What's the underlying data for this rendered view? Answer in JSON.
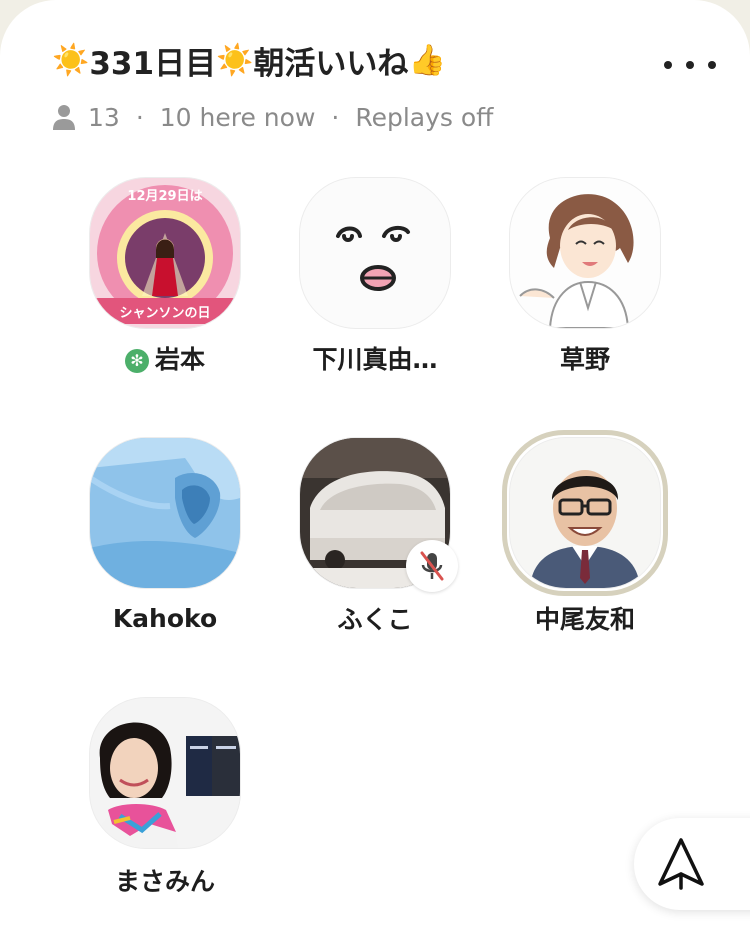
{
  "room": {
    "title_parts": [
      {
        "type": "emoji",
        "value": "☀️"
      },
      {
        "type": "text",
        "value": "331日目"
      },
      {
        "type": "emoji",
        "value": "☀️"
      },
      {
        "type": "text",
        "value": "朝活いいね"
      },
      {
        "type": "emoji",
        "value": "👍"
      }
    ],
    "listener_count": "13",
    "separator": "·",
    "here_now": "10 here now",
    "replays": "Replays off"
  },
  "speakers": [
    {
      "name": "岩本",
      "moderator_badge": "✻",
      "avatar_icon": "chanson-day-icon",
      "avatar_text": [
        "12月29日は",
        "シャンソンの日"
      ],
      "muted": false,
      "speaking": false
    },
    {
      "name": "下川真由…",
      "avatar_icon": "face-doodle-icon",
      "muted": false,
      "speaking": false
    },
    {
      "name": "草野",
      "avatar_icon": "illustrated-woman-icon",
      "muted": false,
      "speaking": false
    },
    {
      "name": "Kahoko",
      "avatar_icon": "blue-object-photo-icon",
      "muted": false,
      "speaking": false
    },
    {
      "name": "ふくこ",
      "avatar_icon": "snow-car-photo-icon",
      "muted": true,
      "speaking": false
    },
    {
      "name": "中尾友和",
      "avatar_icon": "man-portrait-photo-icon",
      "muted": false,
      "speaking": true
    },
    {
      "name": "まさみん",
      "avatar_icon": "woman-portrait-photo-icon",
      "muted": false,
      "speaking": false
    }
  ],
  "icons": {
    "menu": "more-horizontal-icon",
    "person": "person-icon",
    "share": "share-arrow-icon",
    "mute": "mic-muted-icon"
  },
  "colors": {
    "background": "#f1efe6",
    "sheet": "#ffffff",
    "text": "#1e1e1e",
    "muted_text": "#8a8a8a",
    "moderator_green": "#4caf6a",
    "speaking_ring": "#d6d1bd",
    "mute_red": "#d9534f"
  }
}
